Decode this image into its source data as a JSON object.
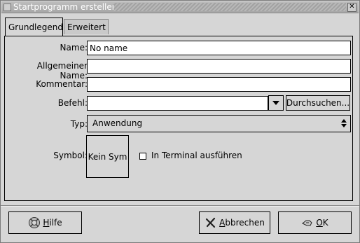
{
  "window": {
    "title": "Startprogramm erstellen",
    "close_label": "✕"
  },
  "tabs": [
    {
      "label": "Grundlegend",
      "active": true
    },
    {
      "label": "Erweitert",
      "active": false
    }
  ],
  "fields": {
    "name": {
      "label": "Name:",
      "value": "No name"
    },
    "generic_name": {
      "label": "Allgemeiner Name:",
      "value": ""
    },
    "comment": {
      "label": "Kommentar:",
      "value": ""
    },
    "command": {
      "label": "Befehl:",
      "value": "",
      "browse_label": "Durchsuchen..."
    },
    "type": {
      "label": "Typ:",
      "value": "Anwendung"
    },
    "icon": {
      "label": "Symbol:",
      "button_label": "Kein Sym"
    },
    "terminal": {
      "label": "In Terminal ausführen",
      "checked": false
    }
  },
  "buttons": {
    "help": {
      "label_underlined": "H",
      "label_rest": "ilfe",
      "icon": "lifebuoy-icon"
    },
    "cancel": {
      "label_underlined": "A",
      "label_rest": "bbrechen",
      "icon": "cancel-x-icon"
    },
    "ok": {
      "label_underlined": "O",
      "label_rest": "K",
      "icon": "ok-hand-icon"
    }
  }
}
